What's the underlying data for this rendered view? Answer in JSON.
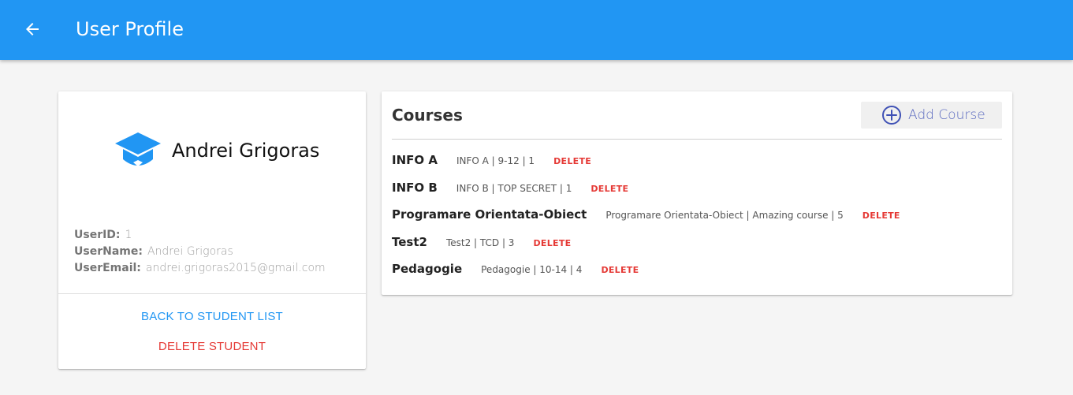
{
  "appbar": {
    "title": "User Profile",
    "back_icon": "arrow-back-icon",
    "color": "#2196f3"
  },
  "profile": {
    "name": "Andrei Grigoras",
    "avatar_icon": "graduation-cap-icon",
    "fields": [
      {
        "label": "UserID:",
        "value": "1"
      },
      {
        "label": "UserName:",
        "value": "Andrei Grigoras"
      },
      {
        "label": "UserEmail:",
        "value": "andrei.grigoras2015@gmail.com"
      }
    ],
    "back_button": "BACK TO STUDENT LIST",
    "delete_button": "DELETE STUDENT"
  },
  "courses": {
    "title": "Courses",
    "add_button": "Add Course",
    "add_icon": "add-circle-icon",
    "delete_label": "DELETE",
    "items": [
      {
        "name": "INFO A",
        "details": "INFO A | 9-12 | 1"
      },
      {
        "name": "INFO B",
        "details": "INFO B | TOP SECRET | 1"
      },
      {
        "name": "Programare Orientata-Obiect",
        "details": "Programare Orientata-Obiect | Amazing course | 5"
      },
      {
        "name": "Test2",
        "details": "Test2 | TCD | 3"
      },
      {
        "name": "Pedagogie",
        "details": "Pedagogie | 10-14 | 4"
      }
    ]
  },
  "colors": {
    "primary": "#2196f3",
    "danger": "#e53935",
    "accent": "#5c6bc0"
  }
}
